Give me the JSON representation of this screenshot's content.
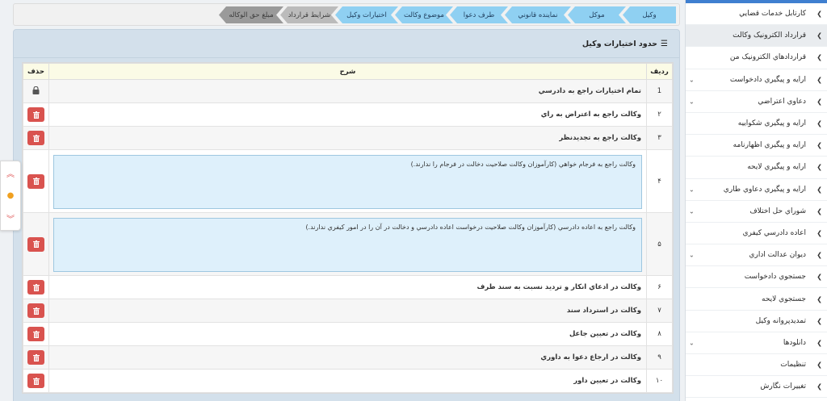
{
  "sidebar": {
    "items": [
      {
        "label": "کارتابل خدمات قضايي",
        "expandable": false,
        "active": false
      },
      {
        "label": "قرارداد الکترونيک وکالت",
        "expandable": false,
        "active": true
      },
      {
        "label": "قراردادهاي الکترونيک من",
        "expandable": false,
        "active": false
      },
      {
        "label": "ارايه و پيگيري دادخواست",
        "expandable": true,
        "active": false
      },
      {
        "label": "دعاوي اعتراضي",
        "expandable": true,
        "active": false
      },
      {
        "label": "ارايه و پيگيري شکواييه",
        "expandable": false,
        "active": false
      },
      {
        "label": "ارايه و پيگيري اظهارنامه",
        "expandable": false,
        "active": false
      },
      {
        "label": "ارايه و پيگيري لايحه",
        "expandable": false,
        "active": false
      },
      {
        "label": "ارايه و پيگيري دعاوي طاري",
        "expandable": true,
        "active": false
      },
      {
        "label": "شوراي حل اختلاف",
        "expandable": true,
        "active": false
      },
      {
        "label": "اعاده دادرسي کيفري",
        "expandable": false,
        "active": false
      },
      {
        "label": "ديوان عدالت اداري",
        "expandable": true,
        "active": false
      },
      {
        "label": "جستجوي دادخواست",
        "expandable": false,
        "active": false
      },
      {
        "label": "جستجوي لايحه",
        "expandable": false,
        "active": false
      },
      {
        "label": "تمديدپروانه وکيل",
        "expandable": false,
        "active": false
      },
      {
        "label": "دانلودها",
        "expandable": true,
        "active": false
      },
      {
        "label": "تنظيمات",
        "expandable": false,
        "active": false
      },
      {
        "label": "تغييرات نگارش",
        "expandable": false,
        "active": false
      }
    ]
  },
  "breadcrumb": {
    "steps": [
      {
        "label": "وکيل",
        "state": "done"
      },
      {
        "label": "موکل",
        "state": "done"
      },
      {
        "label": "نماينده قانوني",
        "state": "done"
      },
      {
        "label": "طرف دعوا",
        "state": "done"
      },
      {
        "label": "موضوع وکالت",
        "state": "done"
      },
      {
        "label": "اختيارات وکيل",
        "state": "current"
      },
      {
        "label": "شرايط قرارداد",
        "state": "pending"
      },
      {
        "label": "مبلغ حق الوکاله",
        "state": "pending"
      }
    ]
  },
  "panel": {
    "title": "حدود اختيارات وکيل"
  },
  "table": {
    "headers": {
      "num": "رديف",
      "desc": "شرح",
      "del": "حذف"
    },
    "rows": [
      {
        "num": "1",
        "desc": "تمام اختيارات راجع به دادرسي",
        "type": "text",
        "locked": true
      },
      {
        "num": "۲",
        "desc": "وکالت راجع به اعتراض به راي",
        "type": "text",
        "locked": false
      },
      {
        "num": "۳",
        "desc": "وکالت راجع به تجديدنظر",
        "type": "text",
        "locked": false
      },
      {
        "num": "۴",
        "desc": "وکالت راجع به فرجام خواهي (کارآموزان وکالت صلاحيت دخالت در فرجام را ندارند.)",
        "type": "textarea",
        "locked": false
      },
      {
        "num": "۵",
        "desc": "وکالت راجع به اعاده دادرسي (کارآموزان وکالت صلاحيت درخواست اعاده دادرسي و دخالت در آن را در امور کيفري ندارند.)",
        "type": "textarea",
        "locked": false
      },
      {
        "num": "۶",
        "desc": "وکالت در ادعاي انکار و ترديد نسبت به سند طرف",
        "type": "text",
        "locked": false
      },
      {
        "num": "۷",
        "desc": "وکالت در استرداد سند",
        "type": "text",
        "locked": false
      },
      {
        "num": "۸",
        "desc": "وکالت در تعيين جاعل",
        "type": "text",
        "locked": false
      },
      {
        "num": "۹",
        "desc": "وکالت در ارجاع دعوا به داوري",
        "type": "text",
        "locked": false
      },
      {
        "num": "۱۰",
        "desc": "وکالت در تعيين داور",
        "type": "text",
        "locked": false
      }
    ]
  },
  "icons": {
    "delete": "trash-icon",
    "lock": "lock-icon",
    "list": "list-icon"
  },
  "colors": {
    "accent": "#3f7fd0",
    "delete_button": "#d9534f",
    "crumb_done": "#8fd0f2",
    "crumb_pending": "#9a9a9a",
    "header_row": "#fbfbe6",
    "textarea_bg": "#def0fb"
  }
}
